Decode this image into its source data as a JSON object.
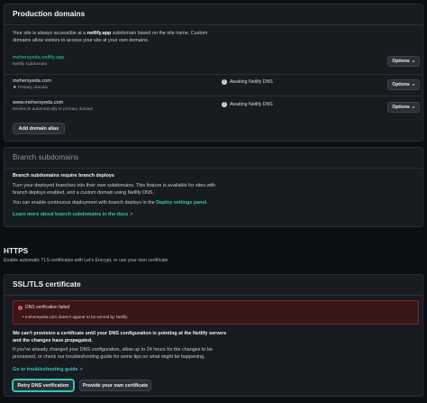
{
  "production_domains": {
    "title": "Production domains",
    "desc_pre": "Your site is always accessible at a ",
    "desc_bold": "netlify.app",
    "desc_post": " subdomain based on the site name. Custom",
    "desc_line2": "domains allow visitors to access your site at your own domains.",
    "domains": [
      {
        "name": "mehersyeda.netlify.app",
        "sub": "Netlify subdomain",
        "status": "",
        "options": "Options"
      },
      {
        "name": "mehersyeda.com",
        "sub": "Primary domain",
        "status": "Awaiting Netlify DNS",
        "options": "Options"
      },
      {
        "name": "www.mehersyeda.com",
        "sub": "Redirects automatically to primary domain",
        "status": "Awaiting Netlify DNS",
        "options": "Options"
      }
    ],
    "add_alias_label": "Add domain alias"
  },
  "branch_subdomains": {
    "title": "Branch subdomains",
    "heading": "Branch subdomains require branch deploys",
    "p1_line1": "Turn your deployed branches into their own subdomains. This feature is available for sites with",
    "p1_line2": "branch deploys enabled, and a custom domain using Netlify DNS.",
    "p2_pre": "You can enable continuous deployment with branch deploys in the ",
    "p2_link": "Deploy settings panel",
    "p2_post": ".",
    "learn_more": "Learn more about branch subdomains in the docs"
  },
  "https": {
    "title": "HTTPS",
    "subtitle": "Enable automatic TLS certificates with Let's Encrypt, or use your own certificate"
  },
  "ssl": {
    "title": "SSL/TLS certificate",
    "alert_title": "DNS verification failed",
    "alert_item": "mehersyeda.com doesn't appear to be served by Netlify",
    "msg_line1": "We can't provision a certificate until your DNS configuration is pointing at the Netlify servers",
    "msg_line2": "and the changes have propagated.",
    "help_line1": "If you've already changed your DNS configuration, allow up to 24 hours for the changes to be",
    "help_line2": "processed, or check our troubleshooting guide for some tips on what might be happening.",
    "guide_link": "Go to troubleshooting guide",
    "retry_label": "Retry DNS verification",
    "own_cert_label": "Provide your own certificate"
  },
  "icons": {
    "warning": "warning-circle-icon",
    "error": "error-circle-icon",
    "external": "external-link-icon",
    "chevron": "chevron-down-icon",
    "star": "star-icon"
  },
  "colors": {
    "accent": "#2fc6b7",
    "background": "#0b0f14",
    "card": "#181b20",
    "alert_bg": "#3b1618"
  }
}
